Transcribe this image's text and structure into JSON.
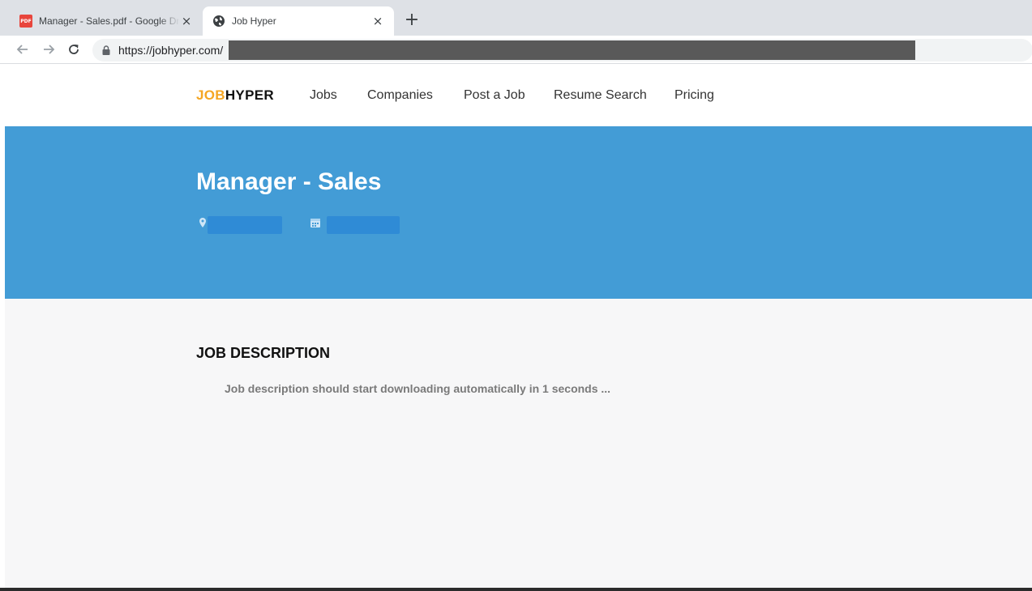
{
  "browser": {
    "tabs": [
      {
        "title": "Manager - Sales.pdf - Google Drive",
        "favicon": "pdf-icon",
        "active": false
      },
      {
        "title": "Job Hyper",
        "favicon": "globe-icon",
        "active": true
      }
    ],
    "favicon_text": "PDF",
    "close_glyph": "×",
    "new_tab_glyph": "+",
    "url": "https://jobhyper.com/"
  },
  "site": {
    "logo_part1": "JOB",
    "logo_part2": "HYPER",
    "nav": [
      "Jobs",
      "Companies",
      "Post a Job",
      "Resume Search",
      "Pricing"
    ]
  },
  "job": {
    "title": "Manager - Sales",
    "meta_icons": [
      "location-pin-icon",
      "calendar-icon"
    ]
  },
  "description": {
    "heading": "JOB DESCRIPTION",
    "message": "Job description should start downloading automatically in 1 seconds ..."
  },
  "colors": {
    "hero_bg": "#439cd6",
    "logo_accent": "#f5a623",
    "tabstrip_bg": "#dee1e6",
    "page_bg": "#f7f7f8"
  }
}
